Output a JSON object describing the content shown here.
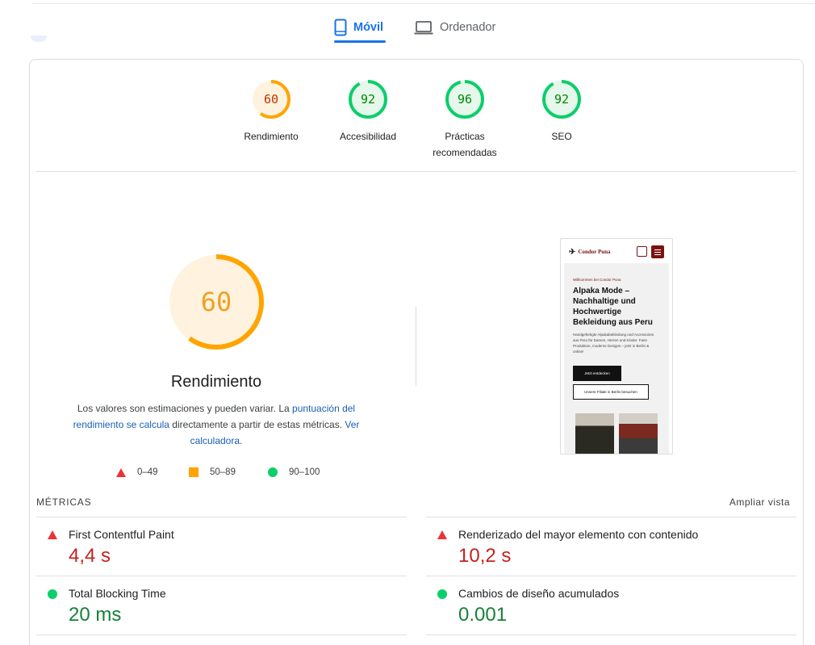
{
  "tabs": {
    "mobile": "Móvil",
    "desktop": "Ordenador",
    "active": "mobile"
  },
  "scores": [
    {
      "name": "performance",
      "label": "Rendimiento",
      "value": 60,
      "color": "#ffa400",
      "text_color": "#c33300",
      "bg": "#fff3e0"
    },
    {
      "name": "accessibility",
      "label": "Accesibilidad",
      "value": 92,
      "color": "#0cce6b",
      "text_color": "#008800",
      "bg": "#e6f7eb"
    },
    {
      "name": "best-practices",
      "label": "Prácticas recomendadas",
      "value": 96,
      "color": "#0cce6b",
      "text_color": "#008800",
      "bg": "#e6f7eb"
    },
    {
      "name": "seo",
      "label": "SEO",
      "value": 92,
      "color": "#0cce6b",
      "text_color": "#008800",
      "bg": "#e6f7eb"
    }
  ],
  "main": {
    "score": "60",
    "title": "Rendimiento",
    "desc_text1": "Los valores son estimaciones y pueden variar. La ",
    "desc_link1": "puntuación del rendimiento se calcula",
    "desc_text2": " directamente a partir de estas métricas. ",
    "desc_link2": "Ver calculadora",
    "desc_text3": "."
  },
  "legend": {
    "fail": "0–49",
    "average": "50–89",
    "pass": "90–100"
  },
  "thumbnail": {
    "logo": "Condor Puna",
    "small": "Willkommen bei Condor Puna",
    "heading": "Alpaka Mode – Nachhaltige und Hochwertige Bekleidung aus Peru",
    "paragraph": "Handgefertigte Alpakabekleidung und Accessoires aus Peru für Damen, Herren und Kinder. Faire Produktion, moderne Designs – jetzt in Berlin & online!",
    "button1": "Jetzt entdecken",
    "button2": "Unsere Filiale in Berlin besuchen"
  },
  "metrics": {
    "header": "MÉTRICAS",
    "expand": "Ampliar vista",
    "items": [
      {
        "name": "First Contentful Paint",
        "value": "4,4 s",
        "status": "fail"
      },
      {
        "name": "Renderizado del mayor elemento con contenido",
        "value": "10,2 s",
        "status": "fail"
      },
      {
        "name": "Total Blocking Time",
        "value": "20 ms",
        "status": "pass"
      },
      {
        "name": "Cambios de diseño acumulados",
        "value": "0.001",
        "status": "pass"
      }
    ]
  }
}
